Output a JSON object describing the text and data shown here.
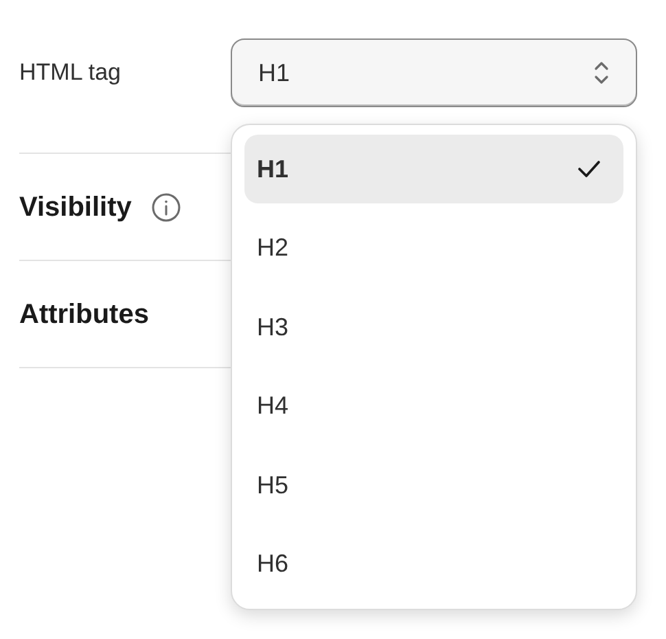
{
  "field": {
    "label": "HTML tag",
    "value": "H1"
  },
  "sections": [
    {
      "title": "Visibility",
      "info": true
    },
    {
      "title": "Attributes",
      "info": false
    }
  ],
  "menu": {
    "items": [
      {
        "label": "H1",
        "selected": true
      },
      {
        "label": "H2",
        "selected": false
      },
      {
        "label": "H3",
        "selected": false
      },
      {
        "label": "H4",
        "selected": false
      },
      {
        "label": "H5",
        "selected": false
      },
      {
        "label": "H6",
        "selected": false
      }
    ]
  }
}
